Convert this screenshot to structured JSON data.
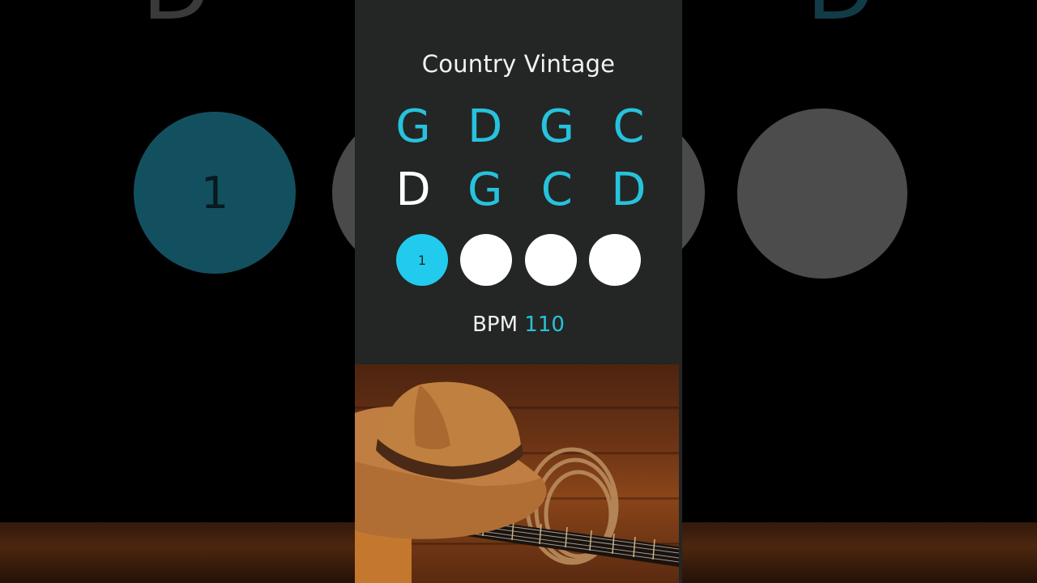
{
  "background": {
    "left_letter": "D",
    "right_letter": "D",
    "circle_label": "1"
  },
  "panel": {
    "title": "Country Vintage",
    "chord_rows": [
      [
        "G",
        "D",
        "G",
        "C"
      ],
      [
        "D",
        "G",
        "C",
        "D"
      ]
    ],
    "active_chord": {
      "row": 1,
      "index": 0
    },
    "beats": [
      {
        "label": "1",
        "on": true
      },
      {
        "label": "",
        "on": false
      },
      {
        "label": "",
        "on": false
      },
      {
        "label": "",
        "on": false
      }
    ],
    "bpm_label": "BPM",
    "bpm_value": "110"
  },
  "colors": {
    "accent": "#27c2dd",
    "beat_on": "#22cbee",
    "panel_bg": "#232624",
    "text": "#f2f2f2"
  },
  "artwork": {
    "icon": "cowboy-hat-guitar-image"
  }
}
